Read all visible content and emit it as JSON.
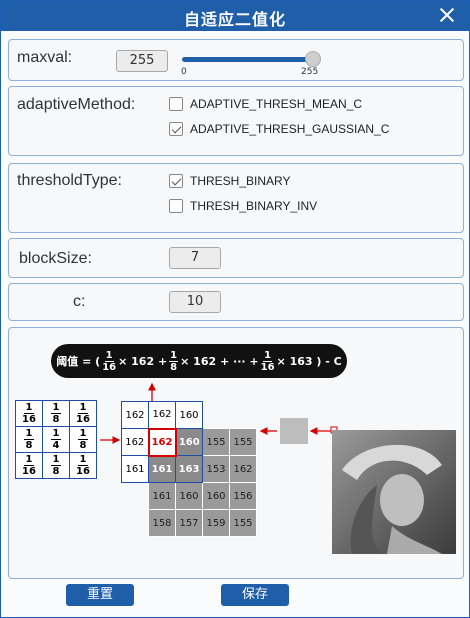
{
  "window": {
    "title": "自适应二值化",
    "close_icon": "close-icon"
  },
  "maxval": {
    "label": "maxval:",
    "value": "255",
    "slider_min": "0",
    "slider_max": "255",
    "slider_fraction": 1.0
  },
  "adaptive": {
    "label": "adaptiveMethod:",
    "options": [
      {
        "label": "ADAPTIVE_THRESH_MEAN_C",
        "checked": false
      },
      {
        "label": "ADAPTIVE_THRESH_GAUSSIAN_C",
        "checked": true
      }
    ]
  },
  "threshold": {
    "label": "thresholdType:",
    "options": [
      {
        "label": "THRESH_BINARY",
        "checked": true
      },
      {
        "label": "THRESH_BINARY_INV",
        "checked": false
      }
    ]
  },
  "blocksize": {
    "label": "blockSize:",
    "value": "7"
  },
  "c": {
    "label": "c:",
    "value": "10"
  },
  "illustration": {
    "formula": {
      "prefix": "阈值 = (",
      "f1": {
        "num": "1",
        "den": "16"
      },
      "t1": "× 162 +",
      "f2": {
        "num": "1",
        "den": "8"
      },
      "t2": "× 162 + ··· +",
      "f3": {
        "num": "1",
        "den": "16"
      },
      "t3": "× 163 ) - C"
    },
    "kernel": [
      [
        {
          "num": "1",
          "den": "16"
        },
        {
          "num": "1",
          "den": "8"
        },
        {
          "num": "1",
          "den": "16"
        }
      ],
      [
        {
          "num": "1",
          "den": "8"
        },
        {
          "num": "1",
          "den": "4"
        },
        {
          "num": "1",
          "den": "8"
        }
      ],
      [
        {
          "num": "1",
          "den": "16"
        },
        {
          "num": "1",
          "den": "8"
        },
        {
          "num": "1",
          "den": "16"
        }
      ]
    ],
    "pixels": [
      [
        "162",
        "162",
        "160",
        "",
        ""
      ],
      [
        "162",
        "162",
        "160",
        "155",
        "155"
      ],
      [
        "161",
        "161",
        "163",
        "153",
        "162"
      ],
      [
        "",
        "161",
        "160",
        "160",
        "156"
      ],
      [
        "",
        "158",
        "157",
        "159",
        "155"
      ]
    ]
  },
  "buttons": {
    "reset": "重置",
    "save": "保存"
  },
  "colors": {
    "accent": "#1f5ea8",
    "highlight": "#d40000"
  }
}
